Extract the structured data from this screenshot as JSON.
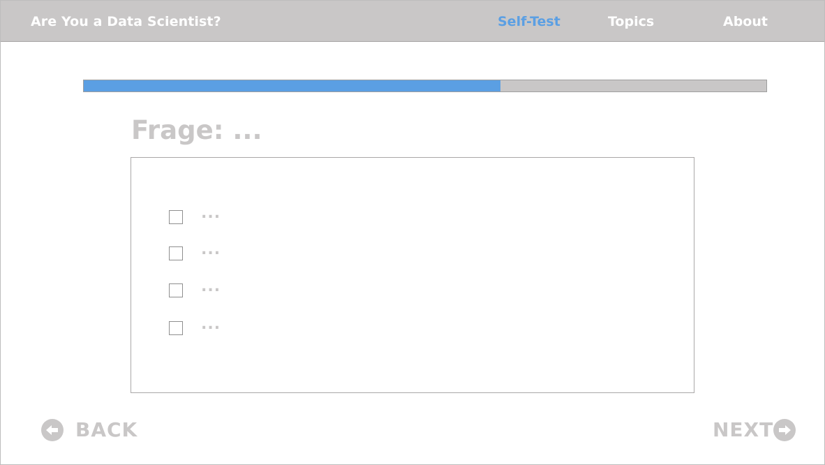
{
  "header": {
    "app_title": "Are You a Data Scientist?",
    "nav": [
      {
        "label": "Self-Test",
        "active": true
      },
      {
        "label": "Topics",
        "active": false
      },
      {
        "label": "About",
        "active": false
      }
    ]
  },
  "progress": {
    "fraction": 0.61
  },
  "question": {
    "title": "Frage: ...",
    "options": [
      {
        "label": "...",
        "checked": false
      },
      {
        "label": "...",
        "checked": false
      },
      {
        "label": "...",
        "checked": false
      },
      {
        "label": "...",
        "checked": false
      }
    ]
  },
  "footer": {
    "back_label": "BACK",
    "next_label": "NEXT",
    "back_icon": "arrow-left-circle-icon",
    "next_icon": "arrow-right-circle-icon"
  },
  "colors": {
    "accent": "#5b9fe3",
    "header_bg": "#c9c7c7",
    "muted_text": "#c9c7c7"
  }
}
